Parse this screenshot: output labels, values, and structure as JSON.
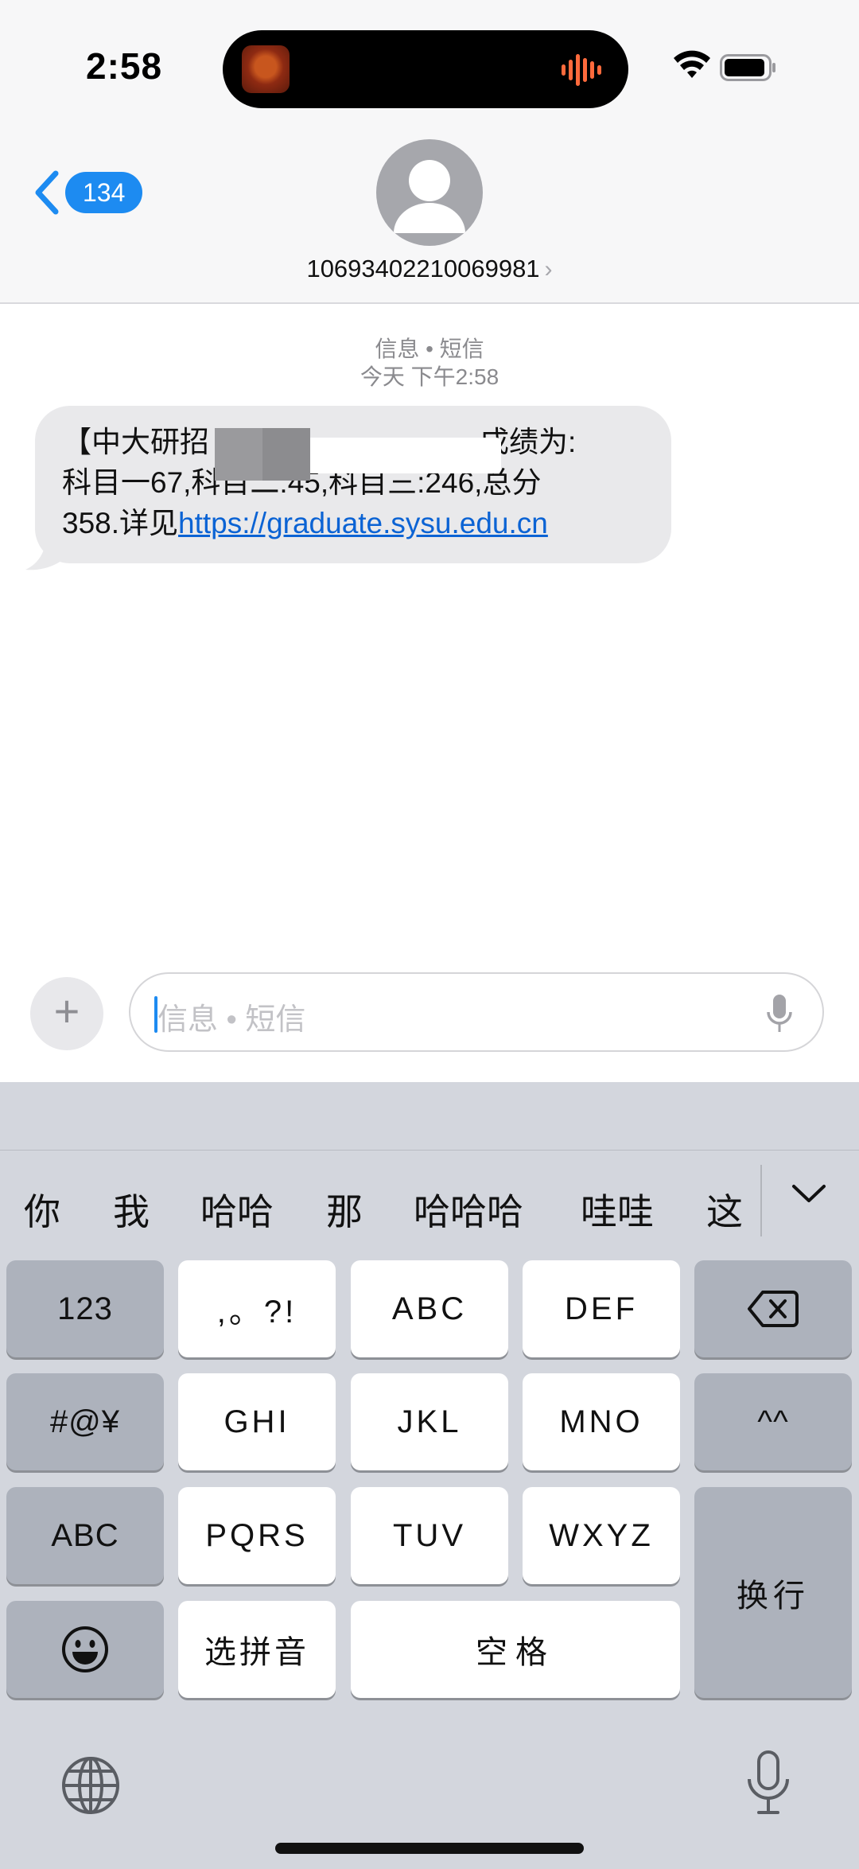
{
  "status_bar": {
    "time": "2:58"
  },
  "header": {
    "back_count": "134",
    "contact_number": "10693402210069981",
    "contact_chevron": "›"
  },
  "conversation": {
    "service_label": "信息 • 短信",
    "timestamp": "今天 下午2:58",
    "message": {
      "line1_prefix": "【中大研招",
      "line1_suffix": "成绩为:",
      "line2": "科目一67,科目二:45,科目三:246,总分",
      "line3_prefix": "358.详见",
      "link": "https://graduate.sysu.edu.cn"
    }
  },
  "compose": {
    "plus_label": "+",
    "placeholder": "信息 • 短信"
  },
  "keyboard": {
    "candidates": [
      "你",
      "我",
      "哈哈",
      "那",
      "哈哈哈",
      "哇哇",
      "这"
    ],
    "keys": {
      "num": "123",
      "punct": ",。?!",
      "abc_key": "ABC",
      "def": "DEF",
      "symbols": "#@¥",
      "ghi": "GHI",
      "jkl": "JKL",
      "mno": "MNO",
      "emoticon": "^^",
      "abc_mode": "ABC",
      "pqrs": "PQRS",
      "tuv": "TUV",
      "wxyz": "WXYZ",
      "return": "换行",
      "pinyin": "选拼音",
      "space": "空格"
    }
  }
}
